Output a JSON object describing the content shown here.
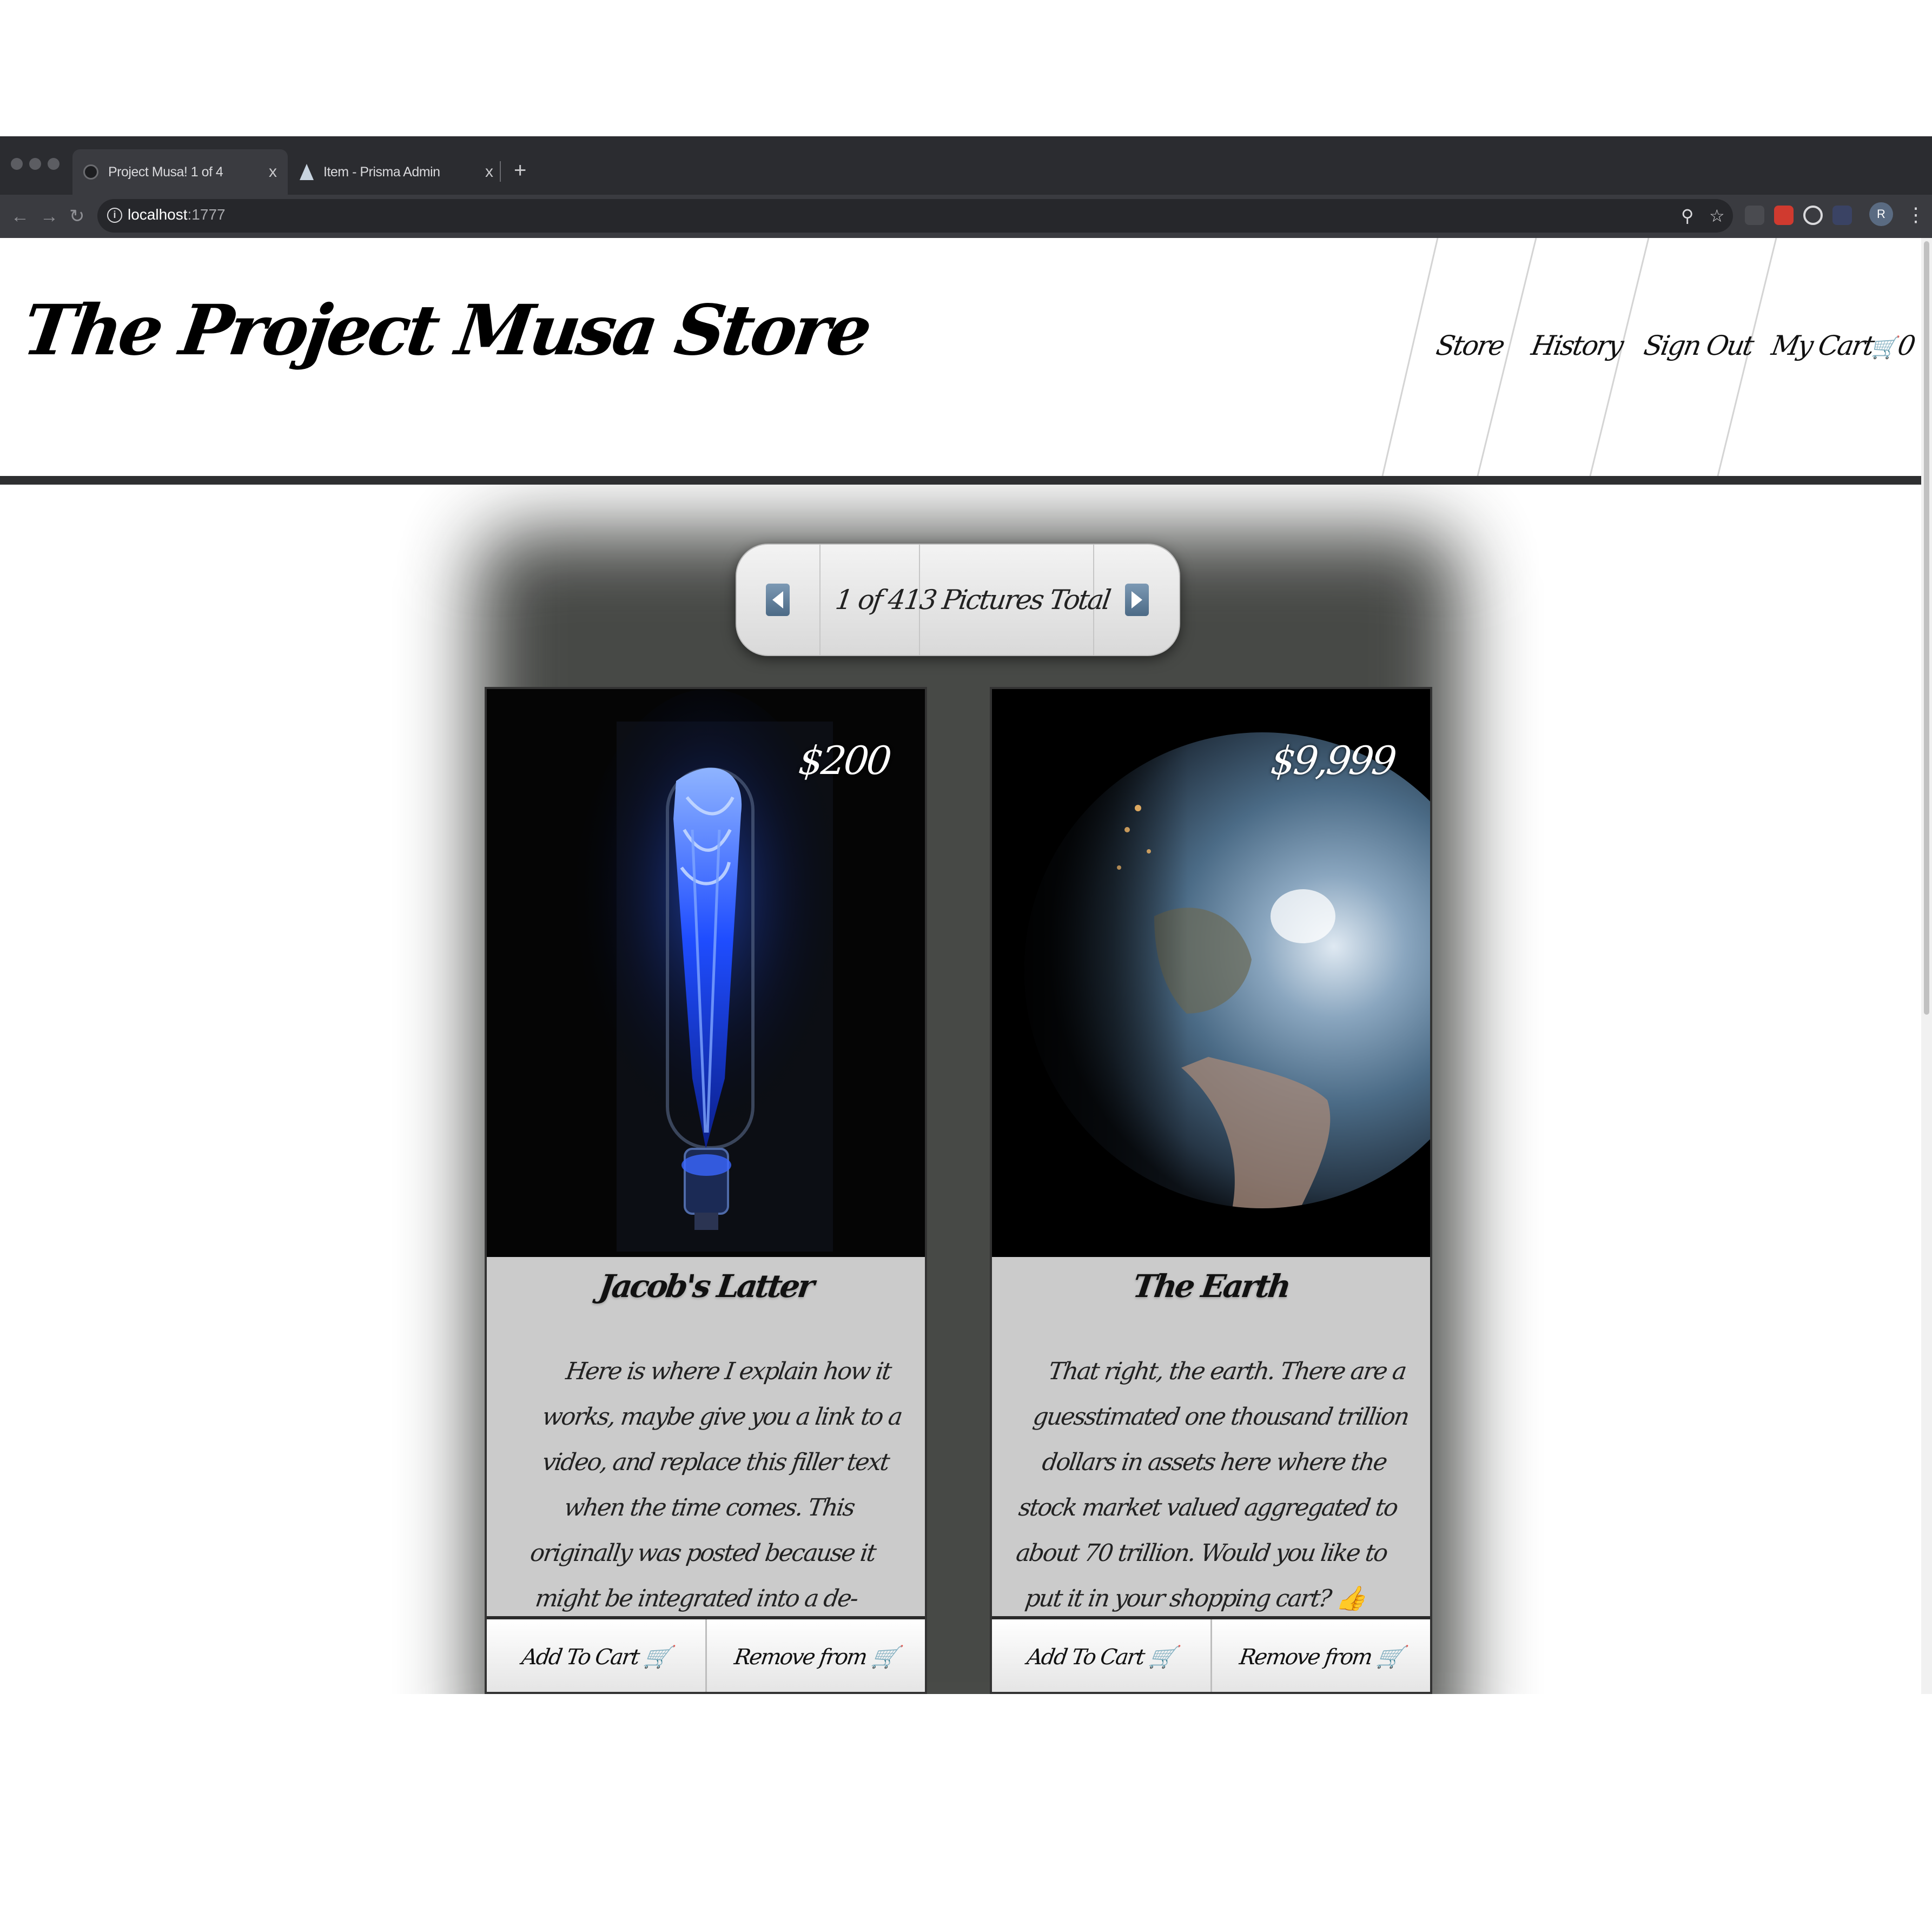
{
  "browser": {
    "tabs": [
      {
        "title": "Project Musa! 1 of 4",
        "close": "x"
      },
      {
        "title": "Item - Prisma Admin",
        "close": "x"
      }
    ],
    "new_tab": "+",
    "url_host": "localhost",
    "url_port": ":1777",
    "toolbar_icons": [
      "back-icon",
      "forward-icon",
      "reload-icon",
      "info-icon",
      "zoom-icon",
      "star-icon",
      "extension-icons",
      "profile-avatar",
      "menu-icon"
    ],
    "profile_initial": "R",
    "extension_colors": [
      "#4a4b50",
      "#d03a2f",
      "#d9d9dc",
      "#3b4f9a"
    ]
  },
  "site": {
    "logo": "The Project Musa Store",
    "nav": {
      "store": "Store",
      "history": "History",
      "sign_out": "Sign Out",
      "cart_label": "My Cart",
      "cart_icon": "🛒",
      "cart_count": "0"
    }
  },
  "pager": {
    "page_text": "1 of 4",
    "total_text": "13 Pictures Total",
    "prev_icon": "prev-arrow-icon",
    "next_icon": "next-arrow-icon",
    "accent": "#5d7b97"
  },
  "cards": [
    {
      "price": "$200",
      "title": "Jacob's Latter",
      "description": "Here is where I explain how it works, maybe give you a link to a video, and replace this filler text when the time comes. This originally was posted because it might be integrated into a de-stressing device. They are really fun to play with!",
      "add_label": "Add To Cart 🛒",
      "remove_label": "Remove from 🛒",
      "image": "glowing-blue-plasma-tube"
    },
    {
      "price": "$9,999",
      "title": "The Earth",
      "description": "That right, the earth. There are a guesstimated one thousand trillion dollars in assets here where the stock market valued aggregated to about 70 trillion. Would you like to put it in your shopping cart? 👍",
      "add_label": "Add To Cart 🛒",
      "remove_label": "Remove from 🛒",
      "image": "earth-from-space"
    }
  ]
}
